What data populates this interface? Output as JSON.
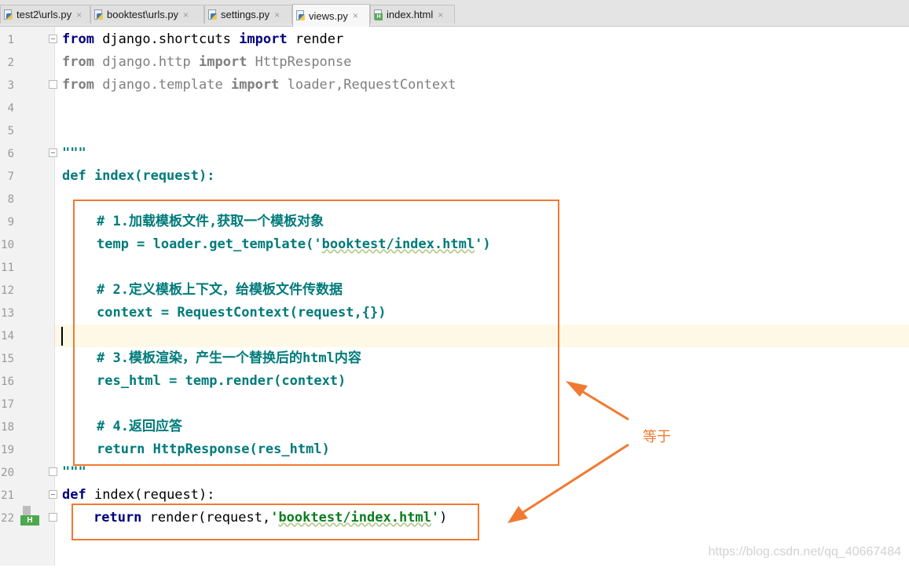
{
  "tabs": [
    {
      "label": "test2\\urls.py",
      "icon": "python-file-icon",
      "active": false
    },
    {
      "label": "booktest\\urls.py",
      "icon": "python-file-icon",
      "active": false
    },
    {
      "label": "settings.py",
      "icon": "python-file-icon",
      "active": false
    },
    {
      "label": "views.py",
      "icon": "python-file-icon",
      "active": true
    },
    {
      "label": "index.html",
      "icon": "html-file-icon",
      "active": false
    }
  ],
  "close_glyph": "×",
  "line_numbers": [
    "1",
    "2",
    "3",
    "4",
    "5",
    "6",
    "7",
    "8",
    "9",
    "10",
    "11",
    "12",
    "13",
    "14",
    "15",
    "16",
    "17",
    "18",
    "19",
    "20",
    "21",
    "22"
  ],
  "code": {
    "l1": {
      "kw1": "from",
      "mod": " django.shortcuts ",
      "kw2": "import",
      "name": " render"
    },
    "l2": {
      "kw1": "from",
      "mod": " django.http ",
      "kw2": "import",
      "name": " HttpResponse"
    },
    "l3": {
      "kw1": "from",
      "mod": " django.template ",
      "kw2": "import",
      "name": " loader,RequestContext"
    },
    "l6": "\"\"\"",
    "l7": "def index(request):",
    "l9": "# 1.加载模板文件,获取一个模板对象",
    "l10": {
      "pre": "temp = loader.get_template(",
      "str_open": "'",
      "str": "booktest/index.html",
      "str_close": "'",
      "post": ")"
    },
    "l12": "# 2.定义模板上下文，给模板文件传数据",
    "l13": "context = RequestContext(request,{})",
    "l15": "# 3.模板渲染，产生一个替换后的html内容",
    "l16": "res_html = temp.render(context)",
    "l18": "# 4.返回应答",
    "l19": "return HttpResponse(res_html)",
    "l20": "\"\"\"",
    "l21": {
      "kw": "def",
      "rest": " index(request):"
    },
    "l22": {
      "kw": "return",
      "pre": " render(request,",
      "str_open": "'",
      "str": "booktest/index.html",
      "str_close": "'",
      "post": ")"
    }
  },
  "annotation_label": "等于",
  "gutter_badge": "H",
  "watermark": "https://blog.csdn.net/qq_40667484",
  "colors": {
    "annotation": "#f07a32",
    "current_line": "#fdf9e6",
    "keyword": "#000080",
    "docstring": "#0a7d7d"
  }
}
